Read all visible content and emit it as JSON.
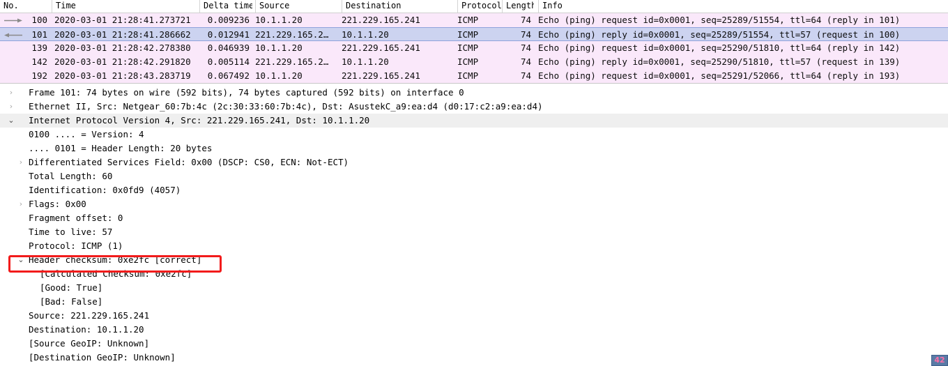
{
  "packet_list": {
    "columns": [
      {
        "key": "no",
        "label": "No."
      },
      {
        "key": "time",
        "label": "Time"
      },
      {
        "key": "delta",
        "label": "Delta time"
      },
      {
        "key": "src",
        "label": "Source"
      },
      {
        "key": "dst",
        "label": "Destination"
      },
      {
        "key": "proto",
        "label": "Protocol"
      },
      {
        "key": "len",
        "label": "Length"
      },
      {
        "key": "info",
        "label": "Info"
      }
    ],
    "rows": [
      {
        "no": "100",
        "time": "2020-03-01 21:28:41.273721",
        "delta": "0.009236",
        "src": "10.1.1.20",
        "dst": "221.229.165.241",
        "proto": "ICMP",
        "len": "74",
        "info": "Echo (ping) request  id=0x0001, seq=25289/51554, ttl=64 (reply in 101)",
        "direction": "request",
        "selected": false
      },
      {
        "no": "101",
        "time": "2020-03-01 21:28:41.286662",
        "delta": "0.012941",
        "src": "221.229.165.2…",
        "dst": "10.1.1.20",
        "proto": "ICMP",
        "len": "74",
        "info": "Echo (ping) reply    id=0x0001, seq=25289/51554, ttl=57 (request in 100)",
        "direction": "reply",
        "selected": true
      },
      {
        "no": "139",
        "time": "2020-03-01 21:28:42.278380",
        "delta": "0.046939",
        "src": "10.1.1.20",
        "dst": "221.229.165.241",
        "proto": "ICMP",
        "len": "74",
        "info": "Echo (ping) request  id=0x0001, seq=25290/51810, ttl=64 (reply in 142)",
        "direction": "none",
        "selected": false
      },
      {
        "no": "142",
        "time": "2020-03-01 21:28:42.291820",
        "delta": "0.005114",
        "src": "221.229.165.2…",
        "dst": "10.1.1.20",
        "proto": "ICMP",
        "len": "74",
        "info": "Echo (ping) reply    id=0x0001, seq=25290/51810, ttl=57 (request in 139)",
        "direction": "none",
        "selected": false
      },
      {
        "no": "192",
        "time": "2020-03-01 21:28:43.283719",
        "delta": "0.067492",
        "src": "10.1.1.20",
        "dst": "221.229.165.241",
        "proto": "ICMP",
        "len": "74",
        "info": "Echo (ping) request  id=0x0001, seq=25291/52066, ttl=64 (reply in 193)",
        "direction": "none",
        "selected": false
      }
    ]
  },
  "packet_detail": {
    "rows": [
      {
        "level": 1,
        "twisty": "collapsed",
        "highlight": false,
        "text": "Frame 101: 74 bytes on wire (592 bits), 74 bytes captured (592 bits) on interface 0"
      },
      {
        "level": 1,
        "twisty": "collapsed",
        "highlight": false,
        "text": "Ethernet II, Src: Netgear_60:7b:4c (2c:30:33:60:7b:4c), Dst: AsustekC_a9:ea:d4 (d0:17:c2:a9:ea:d4)"
      },
      {
        "level": 1,
        "twisty": "expanded",
        "highlight": true,
        "text": "Internet Protocol Version 4, Src: 221.229.165.241, Dst: 10.1.1.20"
      },
      {
        "level": 2,
        "twisty": "none",
        "highlight": false,
        "text": "0100 .... = Version: 4"
      },
      {
        "level": 2,
        "twisty": "none",
        "highlight": false,
        "text": ".... 0101 = Header Length: 20 bytes"
      },
      {
        "level": 2,
        "twisty": "collapsed",
        "highlight": false,
        "text": "Differentiated Services Field: 0x00 (DSCP: CS0, ECN: Not-ECT)"
      },
      {
        "level": 2,
        "twisty": "none",
        "highlight": false,
        "text": "Total Length: 60"
      },
      {
        "level": 2,
        "twisty": "none",
        "highlight": false,
        "text": "Identification: 0x0fd9 (4057)"
      },
      {
        "level": 2,
        "twisty": "collapsed",
        "highlight": false,
        "text": "Flags: 0x00"
      },
      {
        "level": 2,
        "twisty": "none",
        "highlight": false,
        "text": "Fragment offset: 0"
      },
      {
        "level": 2,
        "twisty": "none",
        "highlight": false,
        "text": "Time to live: 57"
      },
      {
        "level": 2,
        "twisty": "none",
        "highlight": false,
        "text": "Protocol: ICMP (1)"
      },
      {
        "level": 2,
        "twisty": "expanded",
        "highlight": false,
        "text": "Header checksum: 0xe2fc [correct]"
      },
      {
        "level": 3,
        "twisty": "none",
        "highlight": false,
        "text": "[Calculated Checksum: 0xe2fc]"
      },
      {
        "level": 3,
        "twisty": "none",
        "highlight": false,
        "text": "[Good: True]"
      },
      {
        "level": 3,
        "twisty": "none",
        "highlight": false,
        "text": "[Bad: False]"
      },
      {
        "level": 2,
        "twisty": "none",
        "highlight": false,
        "text": "Source: 221.229.165.241"
      },
      {
        "level": 2,
        "twisty": "none",
        "highlight": false,
        "text": "Destination: 10.1.1.20"
      },
      {
        "level": 2,
        "twisty": "none",
        "highlight": false,
        "text": "[Source GeoIP: Unknown]"
      },
      {
        "level": 2,
        "twisty": "none",
        "highlight": false,
        "text": "[Destination GeoIP: Unknown]"
      }
    ]
  },
  "annotation": {
    "target_text": "Header checksum: 0xe2fc [correct]",
    "color": "#f21b1b"
  },
  "corner_badge": {
    "text": "42"
  },
  "colors": {
    "row_pink": "#fae8fa",
    "row_selected": "#ccd3f0",
    "row_selected_border": "#8fa2dc",
    "tree_highlight": "#efefef",
    "annotation_red": "#f21b1b"
  },
  "icons": {
    "twisty_collapsed": "›",
    "twisty_expanded": "⌄",
    "arrow_right": "arrow-right-icon",
    "arrow_left": "arrow-left-icon"
  }
}
